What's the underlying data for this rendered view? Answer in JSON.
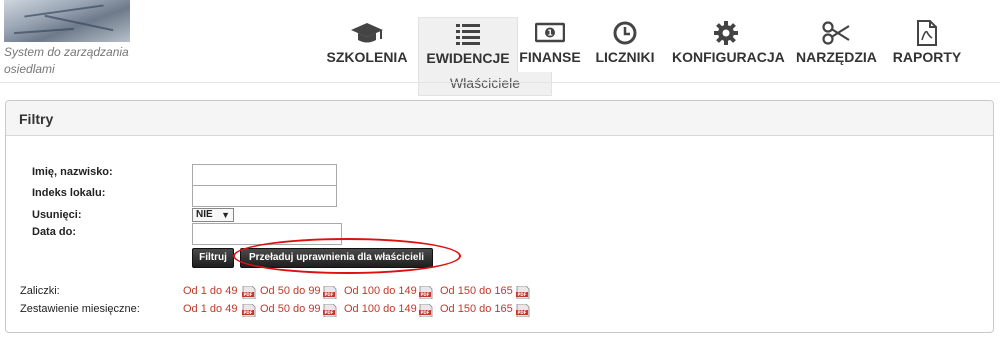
{
  "app": {
    "subtitle": "System do zarządzania osiedlami"
  },
  "nav": {
    "items": [
      {
        "label": "SZKOLENIA",
        "icon": "graduation-cap-icon"
      },
      {
        "label": "EWIDENCJE",
        "icon": "list-icon",
        "active": true
      },
      {
        "label": "FINANSE",
        "icon": "money-icon"
      },
      {
        "label": "LICZNIKI",
        "icon": "clock-icon"
      },
      {
        "label": "KONFIGURACJA",
        "icon": "gear-icon"
      },
      {
        "label": "NARZĘDZIA",
        "icon": "scissors-icon"
      },
      {
        "label": "RAPORTY",
        "icon": "pdf-document-icon"
      }
    ],
    "submenu": {
      "label": "Właściciele"
    }
  },
  "panel": {
    "title": "Filtry"
  },
  "filters": {
    "name_label": "Imię, nazwisko:",
    "name_value": "",
    "index_label": "Indeks lokalu:",
    "index_value": "",
    "deleted_label": "Usunięci:",
    "deleted_value": "NIE",
    "date_label": "Data do:",
    "date_value": "",
    "filter_button": "Filtruj",
    "reload_button": "Przeładuj uprawnienia dla właścicieli"
  },
  "reports": {
    "rows": [
      {
        "label": "Zaliczki:",
        "links": [
          "Od 1 do 49",
          "Od 50 do 99",
          "Od 100 do 149",
          "Od 150 do 165"
        ]
      },
      {
        "label": "Zestawienie miesięczne:",
        "links": [
          "Od 1 do 49",
          "Od 50 do 99",
          "Od 100 do 149",
          "Od 150 do 165"
        ]
      }
    ]
  },
  "colors": {
    "link": "#c0392b",
    "highlight": "#dd1111",
    "button_bg": "#2a2a2a"
  }
}
